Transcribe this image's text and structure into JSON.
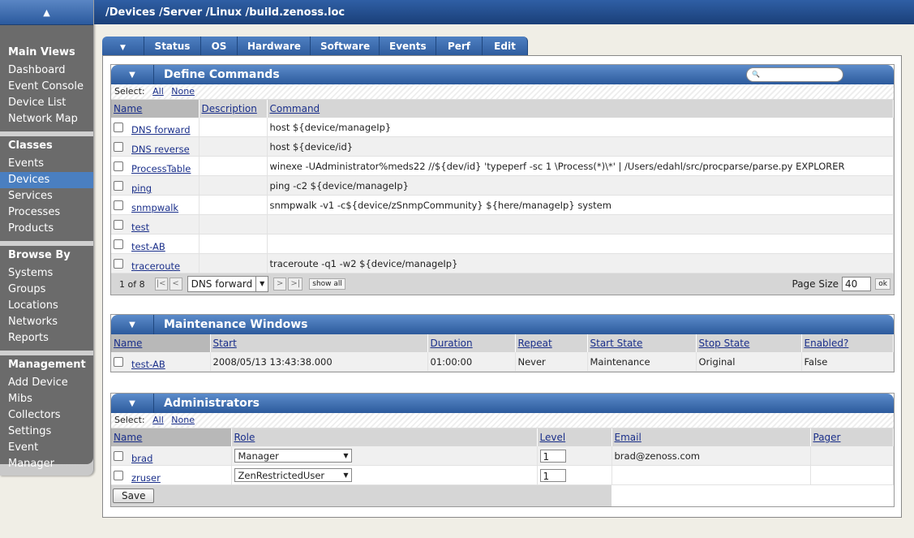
{
  "breadcrumb": "/Devices /Server /Linux /build.zenoss.loc",
  "sidebar": {
    "main_views": {
      "title": "Main Views",
      "items": [
        "Dashboard",
        "Event Console",
        "Device List",
        "Network Map"
      ]
    },
    "classes": {
      "title": "Classes",
      "items": [
        "Events",
        "Devices",
        "Services",
        "Processes",
        "Products"
      ],
      "active": "Devices"
    },
    "browse_by": {
      "title": "Browse By",
      "items": [
        "Systems",
        "Groups",
        "Locations",
        "Networks",
        "Reports"
      ]
    },
    "management": {
      "title": "Management",
      "items": [
        "Add Device",
        "Mibs",
        "Collectors",
        "Settings",
        "Event Manager"
      ]
    }
  },
  "tabs": [
    "Status",
    "OS",
    "Hardware",
    "Software",
    "Events",
    "Perf",
    "Edit"
  ],
  "commands": {
    "title": "Define Commands",
    "select_label": "Select:",
    "select_all": "All",
    "select_none": "None",
    "columns": [
      "Name",
      "Description",
      "Command"
    ],
    "rows": [
      {
        "name": "DNS forward",
        "description": "",
        "command": "host ${device/manageIp}"
      },
      {
        "name": "DNS reverse",
        "description": "",
        "command": "host ${device/id}"
      },
      {
        "name": "ProcessTable",
        "description": "",
        "command": "winexe -UAdministrator%meds22 //${dev/id} 'typeperf -sc 1 \\Process(*)\\*' | /Users/edahl/src/procparse/parse.py EXPLORER"
      },
      {
        "name": "ping",
        "description": "",
        "command": "ping -c2 ${device/manageIp}"
      },
      {
        "name": "snmpwalk",
        "description": "",
        "command": "snmpwalk -v1 -c${device/zSnmpCommunity} ${here/manageIp} system"
      },
      {
        "name": "test",
        "description": "",
        "command": ""
      },
      {
        "name": "test-AB",
        "description": "",
        "command": ""
      },
      {
        "name": "traceroute",
        "description": "",
        "command": "traceroute -q1 -w2 ${device/manageIp}"
      }
    ],
    "pager": {
      "position": "1 of 8",
      "first": "|<",
      "prev": "<",
      "next": ">",
      "last": ">|",
      "selected": "DNS forward",
      "show_all": "show all",
      "page_size_label": "Page Size",
      "page_size": "40",
      "ok": "ok"
    }
  },
  "maintenance": {
    "title": "Maintenance Windows",
    "columns": [
      "Name",
      "Start",
      "Duration",
      "Repeat",
      "Start State",
      "Stop State",
      "Enabled?"
    ],
    "rows": [
      {
        "name": "test-AB",
        "start": "2008/05/13 13:43:38.000",
        "duration": "01:00:00",
        "repeat": "Never",
        "start_state": "Maintenance",
        "stop_state": "Original",
        "enabled": "False"
      }
    ]
  },
  "administrators": {
    "title": "Administrators",
    "select_label": "Select:",
    "select_all": "All",
    "select_none": "None",
    "columns": [
      "Name",
      "Role",
      "Level",
      "Email",
      "Pager"
    ],
    "rows": [
      {
        "name": "brad",
        "role": "Manager",
        "level": "1",
        "email": "brad@zenoss.com",
        "pager": ""
      },
      {
        "name": "zruser",
        "role": "ZenRestrictedUser",
        "level": "1",
        "email": "",
        "pager": ""
      }
    ],
    "save_label": "Save"
  },
  "icons": {
    "collapse": "▲",
    "toggle": "▼",
    "search": "🔍",
    "dropdown": "▼"
  }
}
